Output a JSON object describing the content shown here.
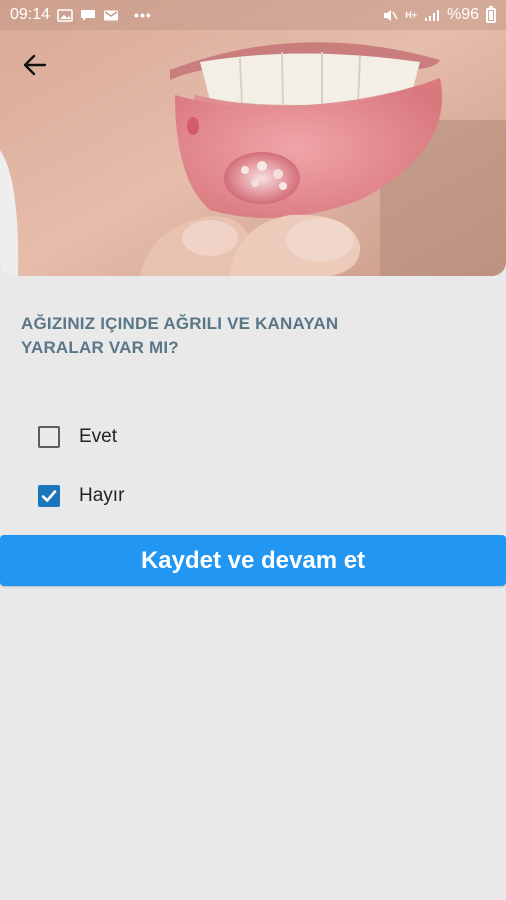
{
  "status_bar": {
    "time": "09:14",
    "notification_icons": [
      "image-icon",
      "chat-icon",
      "mail-icon"
    ],
    "more": "•••",
    "network": "H+",
    "battery": "%96"
  },
  "header": {
    "back_icon": "arrow-left-icon",
    "image_description_icon": "mouth-ulcer-photo"
  },
  "question": {
    "text": "AĞIZINIZ IÇINDE AĞRILI VE KANAYAN YARALAR VAR MI?"
  },
  "options": [
    {
      "label": "Evet",
      "checked": false
    },
    {
      "label": "Hayır",
      "checked": true
    }
  ],
  "actions": {
    "save_continue_label": "Kaydet ve devam et"
  },
  "colors": {
    "background": "#e9e9e9",
    "question_text": "#597787",
    "checkbox_checked": "#1b75bb",
    "button": "#2196f3"
  }
}
